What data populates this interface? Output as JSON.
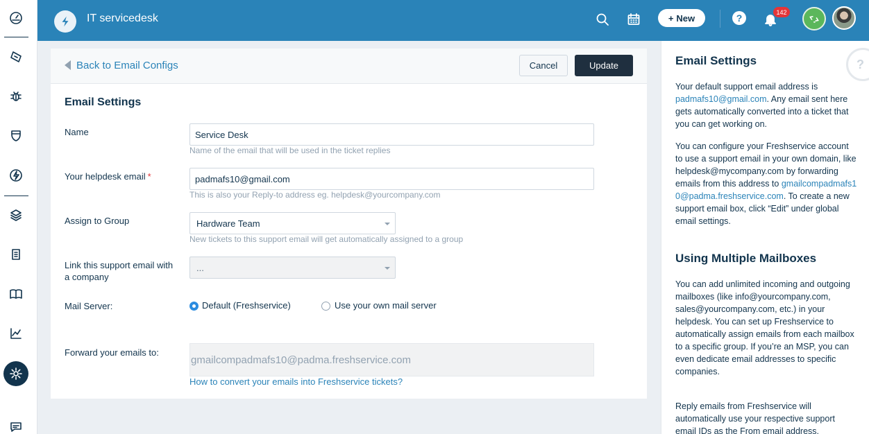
{
  "app": {
    "title": "IT servicedesk",
    "new_button_label": "New",
    "notification_count": "142"
  },
  "left_nav": {
    "items": [
      "dashboard-icon",
      "tickets-icon",
      "problems-icon",
      "changes-icon",
      "releases-icon",
      "assets-icon",
      "contracts-icon",
      "solutions-icon",
      "reports-icon",
      "admin-icon",
      "chat-icon"
    ]
  },
  "panel": {
    "back_label": "Back to Email Configs",
    "cancel_label": "Cancel",
    "update_label": "Update",
    "section_title": "Email Settings",
    "name": {
      "label": "Name",
      "value": "Service Desk",
      "hint": "Name of the email that will be used in the ticket replies"
    },
    "helpdesk_email": {
      "label": "Your helpdesk email",
      "required_mark": "*",
      "value": "padmafs10@gmail.com",
      "hint": "This is also your Reply-to address eg. helpdesk@yourcompany.com"
    },
    "assign_group": {
      "label": "Assign to Group",
      "value": "Hardware Team",
      "hint": "New tickets to this support email will get automatically assigned to a group"
    },
    "link_company": {
      "label": "Link this support email with a company",
      "value": "..."
    },
    "mail_server": {
      "label": "Mail Server:",
      "options": [
        "Default (Freshservice)",
        "Use your own mail server"
      ],
      "selected": "Default (Freshservice)"
    },
    "forward": {
      "label": "Forward your emails to:",
      "value": "gmailcompadmafs10@padma.freshservice.com",
      "help_link": "How to convert your emails into Freshservice tickets?"
    }
  },
  "sidebar": {
    "help_glyph": "?",
    "title1": "Email Settings",
    "p1_a": "Your default support email address is",
    "p1_link": "padmafs10@gmail.com",
    "p1_b": ". Any email sent here gets automatically converted into a ticket that you can get working on.",
    "p2_a": "You can configure your Freshservice account to use a support email in your own domain, like helpdesk@mycompany.com by forwarding emails from this address to",
    "p2_link": "gmailcompadmafs10@padma.freshservice.com",
    "p2_b": ". To create a new support email box, click “Edit” under global email settings.",
    "title2": "Using Multiple Mailboxes",
    "p3": "You can add unlimited incoming and outgoing mailboxes (like info@yourcompany.com, sales@yourcompany.com, etc.) in your helpdesk. You can set up Freshservice to automatically assign emails from each mailbox to a specific group. If you’re an MSP, you can even dedicate email addresses to specific companies.",
    "p4": "Reply emails from Freshservice will automatically use your respective support email IDs as the From email address."
  },
  "colors": {
    "topbar": "#2a83b8",
    "link": "#2a83b8",
    "primary_button": "#1f2f3f",
    "badge": "#e43538"
  }
}
